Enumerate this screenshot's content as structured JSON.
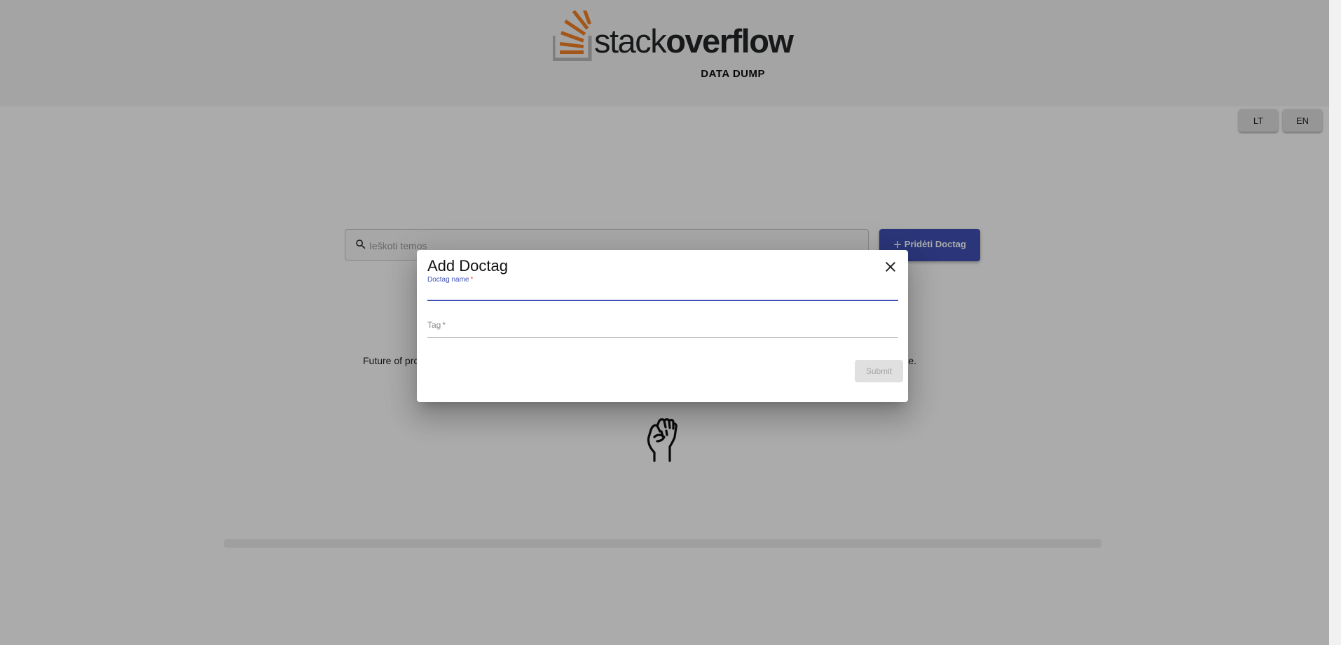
{
  "header": {
    "logo_word_light": "stack",
    "logo_word_bold": "overflow",
    "logo_subtitle": "DATA DUMP"
  },
  "language": {
    "lt_label": "LT",
    "en_label": "EN"
  },
  "search": {
    "placeholder": "Ieškoti temos",
    "value": ""
  },
  "add_button": {
    "icon": "plus-icon",
    "label": "Pridėti Doctag"
  },
  "main": {
    "intro_start": "Future of pro",
    "intro_end": "r your name."
  },
  "dialog": {
    "title": "Add Doctag",
    "close_icon": "close-icon",
    "fields": [
      {
        "label": "Doctag name",
        "required_mark": "*",
        "value": "",
        "state": "focused"
      },
      {
        "label": "Tag",
        "required_mark": "*",
        "value": "",
        "state": "empty"
      }
    ],
    "submit_label": "Submit",
    "submit_state": "disabled"
  },
  "icons": [
    "search-icon",
    "plus-icon",
    "close-icon",
    "raised-fist-icon"
  ],
  "colors": {
    "primary": "#3f51b5",
    "overlay": "rgba(0,0,0,0.33)",
    "logo_orange": "#f48024"
  }
}
